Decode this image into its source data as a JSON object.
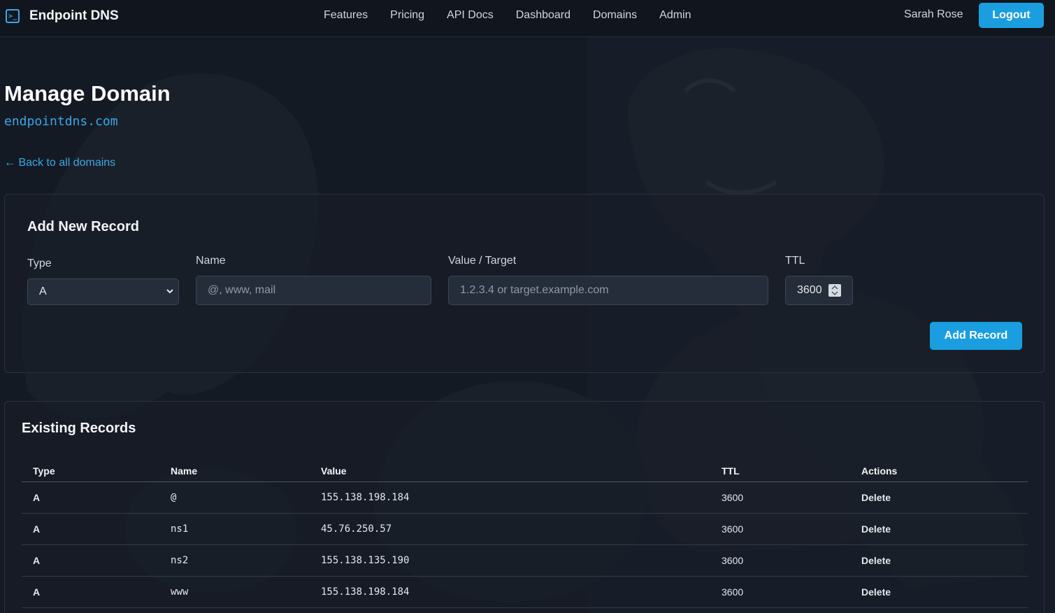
{
  "navbar": {
    "brand": "Endpoint DNS",
    "links": [
      "Features",
      "Pricing",
      "API Docs",
      "Dashboard",
      "Domains",
      "Admin"
    ],
    "user": "Sarah Rose",
    "logout_label": "Logout"
  },
  "header": {
    "title": "Manage Domain",
    "domain": "endpointdns.com",
    "back_link": "← Back to all domains"
  },
  "add_record": {
    "title": "Add New Record",
    "type_label": "Type",
    "type_value": "A",
    "name_label": "Name",
    "name_placeholder": "@, www, mail",
    "value_label": "Value / Target",
    "value_placeholder": "1.2.3.4 or target.example.com",
    "ttl_label": "TTL",
    "ttl_value": "3600",
    "submit_label": "Add Record"
  },
  "records": {
    "title": "Existing Records",
    "columns": [
      "Type",
      "Name",
      "Value",
      "TTL",
      "Actions"
    ],
    "rows": [
      {
        "type": "A",
        "name": "@",
        "value": "155.138.198.184",
        "ttl": "3600",
        "action": "Delete"
      },
      {
        "type": "A",
        "name": "ns1",
        "value": "45.76.250.57",
        "ttl": "3600",
        "action": "Delete"
      },
      {
        "type": "A",
        "name": "ns2",
        "value": "155.138.135.190",
        "ttl": "3600",
        "action": "Delete"
      },
      {
        "type": "A",
        "name": "www",
        "value": "155.138.198.184",
        "ttl": "3600",
        "action": "Delete"
      }
    ]
  },
  "colors": {
    "accent": "#1a9ee0",
    "link": "#3ba7e6",
    "danger": "#ef5b5b",
    "background": "#141a24"
  }
}
